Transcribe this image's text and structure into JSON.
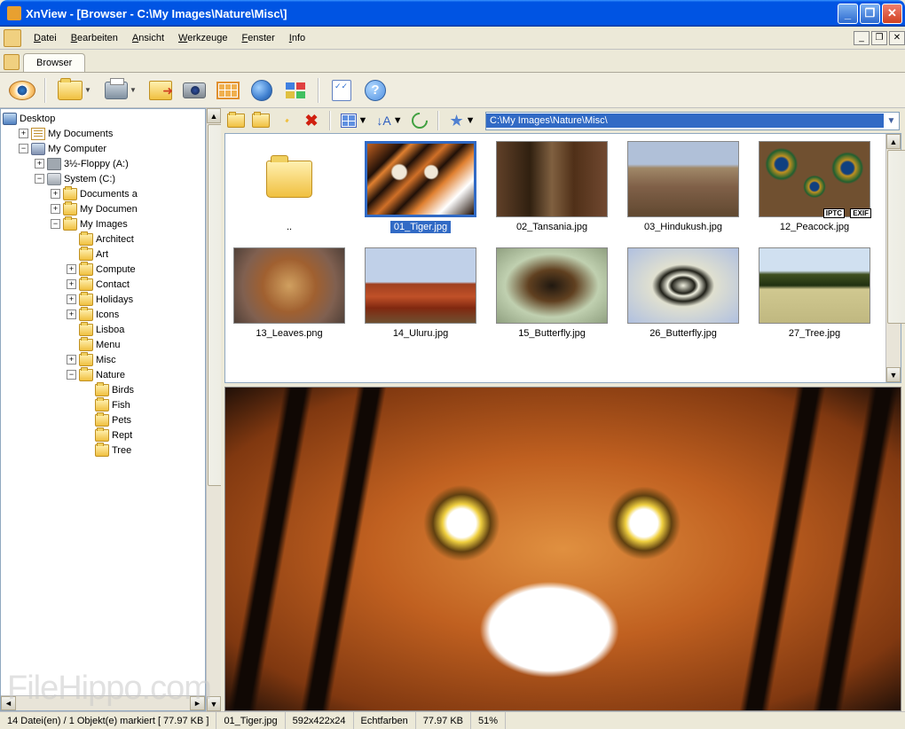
{
  "window": {
    "title": "XnView - [Browser - C:\\My Images\\Nature\\Misc\\]"
  },
  "menu": {
    "datei": "Datei",
    "bearbeiten": "Bearbeiten",
    "ansicht": "Ansicht",
    "werkzeuge": "Werkzeuge",
    "fenster": "Fenster",
    "info": "Info"
  },
  "tab": {
    "browser": "Browser"
  },
  "address": {
    "path": "C:\\My Images\\Nature\\Misc\\"
  },
  "tree": {
    "desktop": "Desktop",
    "my_documents": "My Documents",
    "my_computer": "My Computer",
    "floppy": "3½-Floppy (A:)",
    "system_c": "System (C:)",
    "documents_a": "Documents a",
    "my_documen": "My Documen",
    "my_images": "My Images",
    "architect": "Architect",
    "art": "Art",
    "compute": "Compute",
    "contact": "Contact",
    "holidays": "Holidays",
    "icons": "Icons",
    "lisboa": "Lisboa",
    "menu": "Menu",
    "misc": "Misc",
    "nature": "Nature",
    "birds": "Birds",
    "fish": "Fish",
    "pets": "Pets",
    "rept": "Rept",
    "tree": "Tree"
  },
  "thumbs": {
    "parent": "..",
    "t1": "01_Tiger.jpg",
    "t2": "02_Tansania.jpg",
    "t3": "03_Hindukush.jpg",
    "t4": "12_Peacock.jpg",
    "t5": "13_Leaves.png",
    "t6": "14_Uluru.jpg",
    "t7": "15_Butterfly.jpg",
    "t8": "26_Butterfly.jpg",
    "t9": "27_Tree.jpg",
    "badge_exif": "EXIF",
    "badge_iptc": "IPTC"
  },
  "status": {
    "s1": "14 Datei(en) / 1 Objekt(e) markiert   [ 77.97 KB ]",
    "s2": "01_Tiger.jpg",
    "s3": "592x422x24",
    "s4": "Echtfarben",
    "s5": "77.97 KB",
    "s6": "51%"
  },
  "watermark": "FileHippo.com",
  "help_q": "?"
}
